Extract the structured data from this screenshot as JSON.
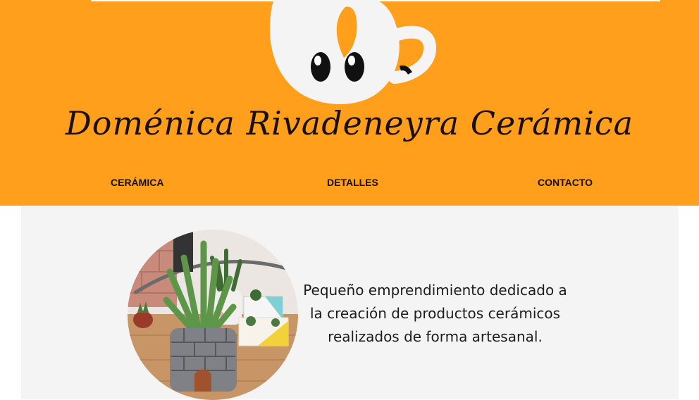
{
  "header": {
    "background": "#ff9f1c",
    "logo_icon": "mug-cat-logo-icon",
    "brand_title": "Doménica Rivadeneyra Cerámica"
  },
  "nav": {
    "items": [
      {
        "label": "CERÁMICA"
      },
      {
        "label": "DETALLES"
      },
      {
        "label": "CONTACTO"
      }
    ]
  },
  "main": {
    "background": "#f4f4f4",
    "photo_icon": "succulent-planters-photo",
    "intro_text": "Pequeño emprendimiento dedicado a la creación de productos cerámicos realizados de forma artesanal."
  }
}
